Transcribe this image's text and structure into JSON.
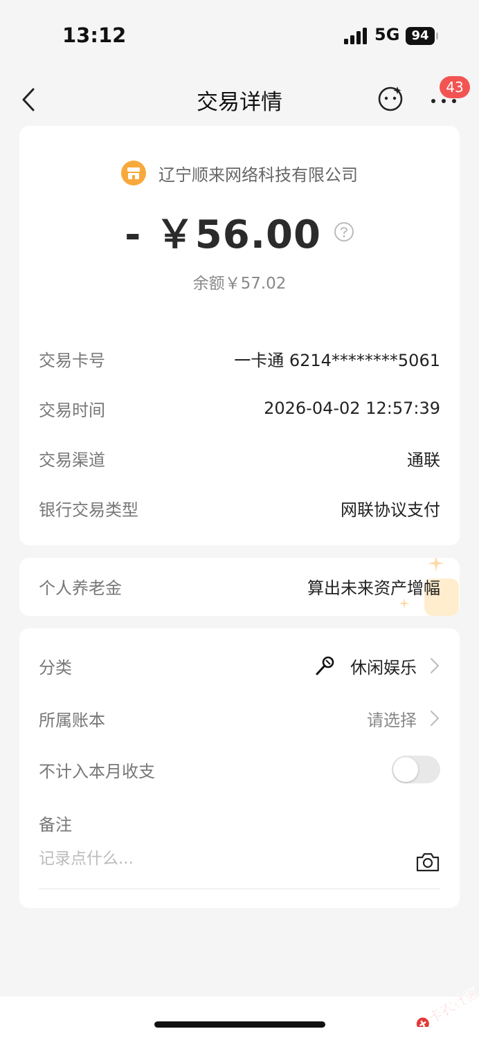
{
  "status": {
    "time": "13:12",
    "network": "5G",
    "battery": "94"
  },
  "nav": {
    "title": "交易详情",
    "badge": "43"
  },
  "transaction": {
    "merchant": "辽宁顺来网络科技有限公司",
    "amount": "- ￥56.00",
    "balance": "余额￥57.02",
    "rows": [
      {
        "label": "交易卡号",
        "value": "一卡通 6214********5061"
      },
      {
        "label": "交易时间",
        "value": "2026-04-02 12:57:39"
      },
      {
        "label": "交易渠道",
        "value": "通联"
      },
      {
        "label": "银行交易类型",
        "value": "网联协议支付"
      }
    ]
  },
  "pension": {
    "label": "个人养老金",
    "value": "算出未来资产增幅"
  },
  "record": {
    "category_label": "分类",
    "category_value": "休闲娱乐",
    "ledger_label": "所属账本",
    "ledger_value": "请选择",
    "exclude_label": "不计入本月收支",
    "exclude_on": false,
    "note_label": "备注",
    "note_placeholder": "记录点什么..."
  },
  "watermark": "卡农社区",
  "colors": {
    "accent_orange": "#f8a93b",
    "badge_red": "#f25452"
  }
}
